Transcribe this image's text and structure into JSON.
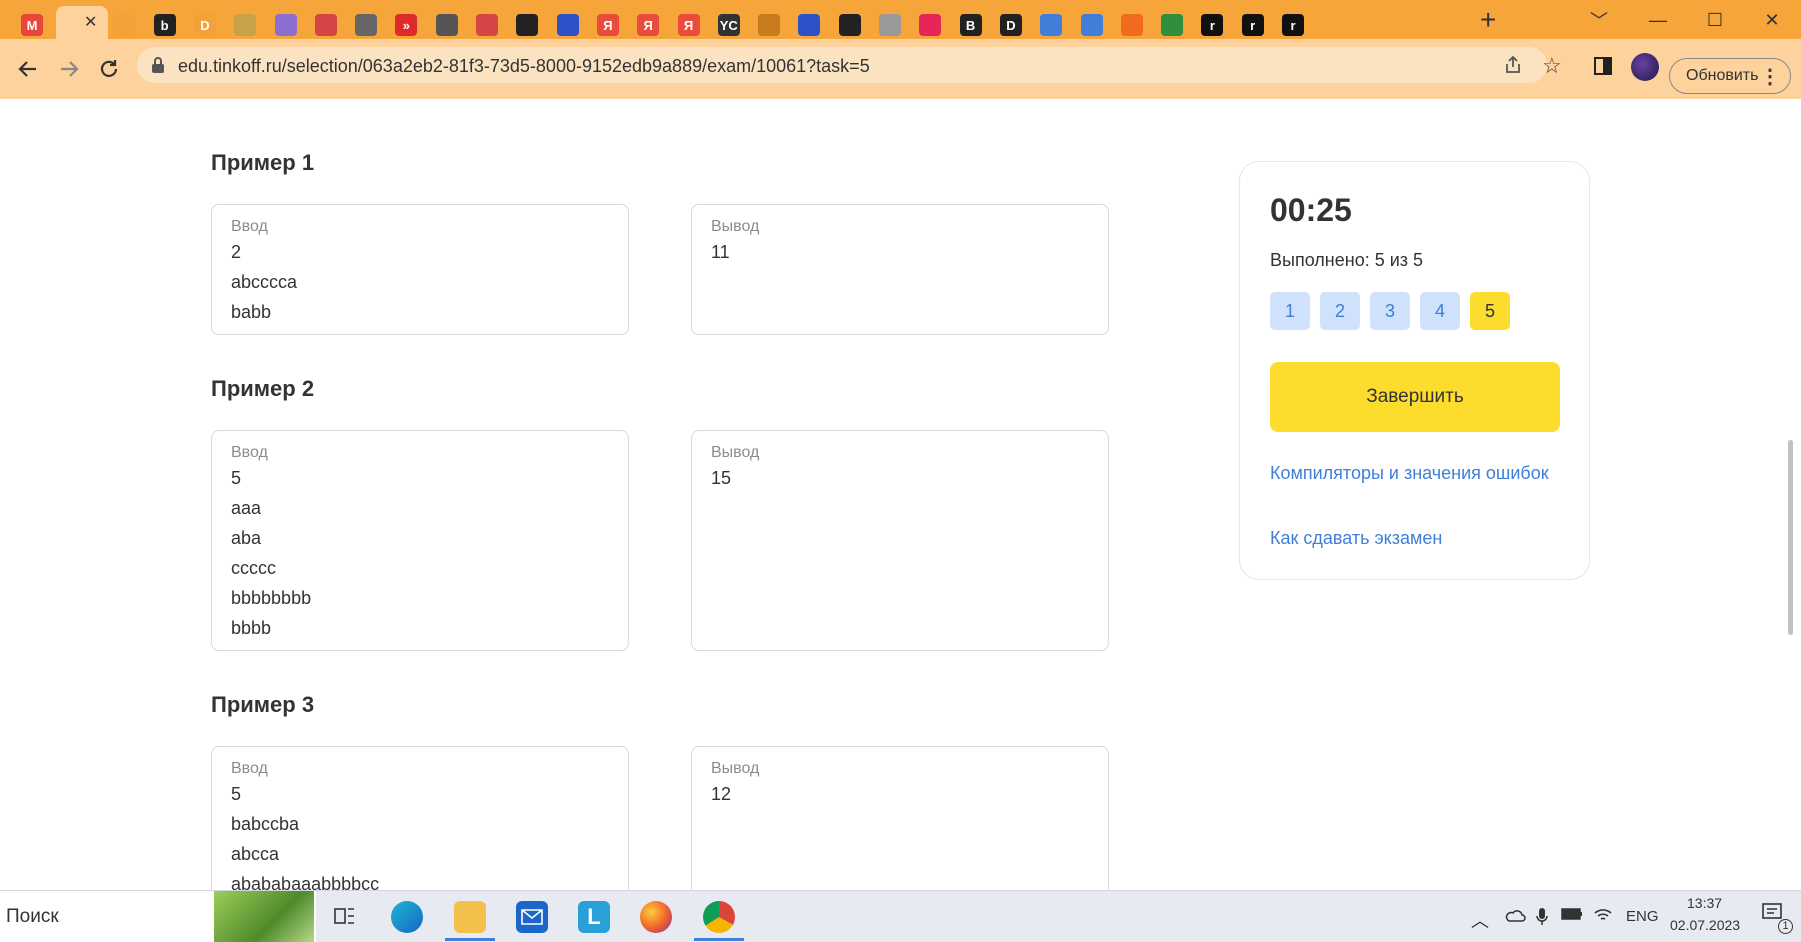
{
  "browser": {
    "active_tab_close": "✕",
    "new_tab": "+",
    "window_controls": [
      "﹀",
      "—",
      "☐",
      "✕"
    ],
    "url": "edu.tinkoff.ru/selection/063a2eb2-81f3-73d5-8000-9152edb9a889/exam/10061?task=5",
    "update_button": "Обновить",
    "tab_favicons": [
      {
        "label": "M",
        "color": "#e8453c"
      },
      {
        "label": "",
        "color": "#f3a239"
      },
      {
        "label": "b",
        "color": "#222"
      },
      {
        "label": "D",
        "color": "#f3a239"
      },
      {
        "label": "",
        "color": "#c8a24a"
      },
      {
        "label": "",
        "color": "#8a6fd1"
      },
      {
        "label": "",
        "color": "#d64545"
      },
      {
        "label": "",
        "color": "#666"
      },
      {
        "label": "»",
        "color": "#e02929"
      },
      {
        "label": "",
        "color": "#555"
      },
      {
        "label": "",
        "color": "#d64545"
      },
      {
        "label": "",
        "color": "#222"
      },
      {
        "label": "",
        "color": "#2d52c8"
      },
      {
        "label": "Я",
        "color": "#e94b3c"
      },
      {
        "label": "Я",
        "color": "#e94b3c"
      },
      {
        "label": "Я",
        "color": "#e94b3c"
      },
      {
        "label": "YC",
        "color": "#333"
      },
      {
        "label": "",
        "color": "#c87a1e"
      },
      {
        "label": "",
        "color": "#2d52c8"
      },
      {
        "label": "",
        "color": "#222"
      },
      {
        "label": "",
        "color": "#999"
      },
      {
        "label": "",
        "color": "#e8255a"
      },
      {
        "label": "B",
        "color": "#222"
      },
      {
        "label": "D",
        "color": "#222"
      },
      {
        "label": "",
        "color": "#3f7fd9"
      },
      {
        "label": "",
        "color": "#3f7fd9"
      },
      {
        "label": "",
        "color": "#f06b1f"
      },
      {
        "label": "",
        "color": "#2f8f3a"
      },
      {
        "label": "r",
        "color": "#111"
      },
      {
        "label": "r",
        "color": "#111"
      },
      {
        "label": "r",
        "color": "#111"
      }
    ]
  },
  "examples": [
    {
      "title": "Пример 1",
      "input_label": "Ввод",
      "input_lines": [
        "2",
        "abcccca",
        "babb"
      ],
      "output_label": "Вывод",
      "output_lines": [
        "11"
      ]
    },
    {
      "title": "Пример 2",
      "input_label": "Ввод",
      "input_lines": [
        "5",
        "aaa",
        "aba",
        "ccccc",
        "bbbbbbbb",
        "bbbb"
      ],
      "output_label": "Вывод",
      "output_lines": [
        "15"
      ]
    },
    {
      "title": "Пример 3",
      "input_label": "Ввод",
      "input_lines": [
        "5",
        "babccba",
        "abcca",
        "abababaaabbbbcc"
      ],
      "output_label": "Вывод",
      "output_lines": [
        "12"
      ]
    }
  ],
  "panel": {
    "timer": "00:25",
    "done": "Выполнено: 5 из 5",
    "tasks": [
      "1",
      "2",
      "3",
      "4",
      "5"
    ],
    "active_task": "5",
    "finish_button": "Завершить",
    "link_compilers": "Компиляторы и значения ошибок",
    "link_howto": "Как сдавать экзамен"
  },
  "taskbar": {
    "search_placeholder": "Поиск",
    "language": "ENG",
    "time": "13:37",
    "date": "02.07.2023",
    "notification_count": "1"
  }
}
